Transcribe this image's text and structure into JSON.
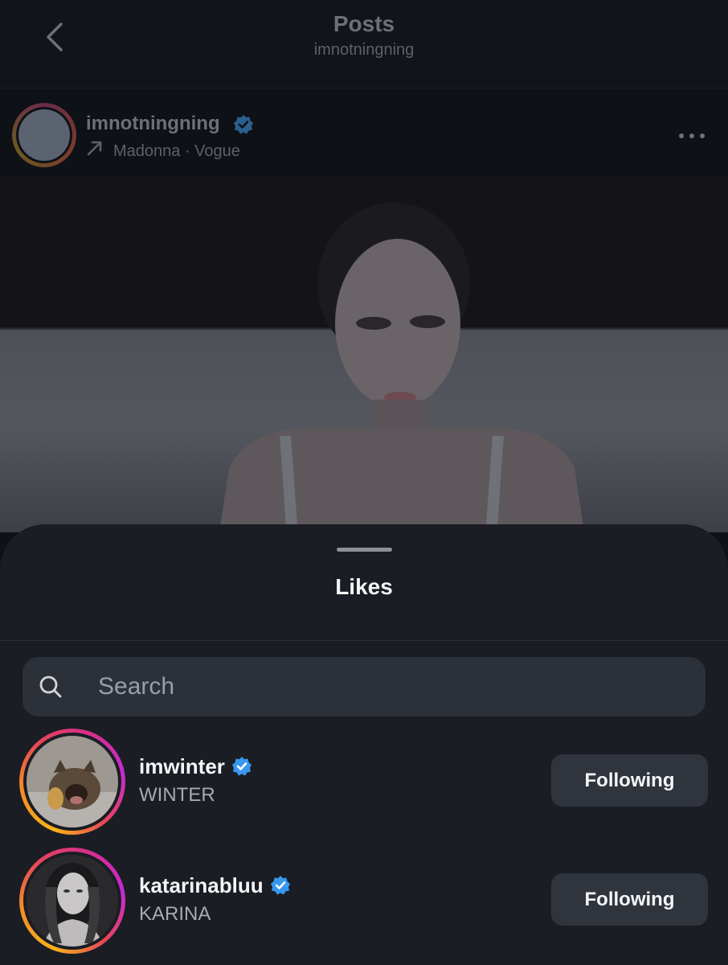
{
  "nav": {
    "title": "Posts",
    "subtitle": "imnotningning"
  },
  "post": {
    "username": "imnotningning",
    "audio": "Madonna · Vogue"
  },
  "likes_sheet": {
    "title": "Likes",
    "search_placeholder": "Search",
    "users": [
      {
        "username": "imwinter",
        "full_name": "WINTER",
        "button_label": "Following"
      },
      {
        "username": "katarinabluu",
        "full_name": "KARINA",
        "button_label": "Following"
      }
    ]
  },
  "colors": {
    "verified_badge": "#3897f0",
    "sheet_background": "#1a1d23",
    "button_background": "#30343c"
  },
  "icons": [
    "back-chevron-icon",
    "verified-badge-icon",
    "music-arrow-icon",
    "more-options-icon",
    "search-icon"
  ]
}
